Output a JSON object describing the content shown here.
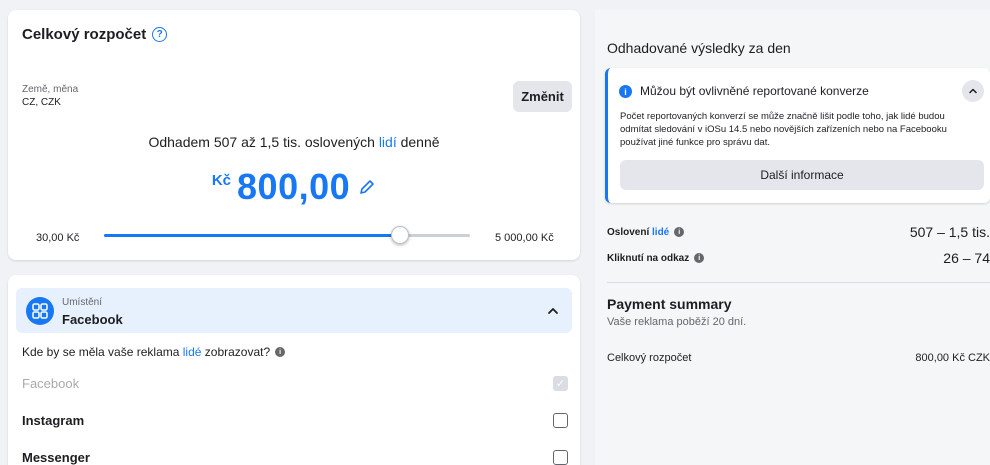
{
  "budget": {
    "title": "Celkový rozpočet",
    "country_label": "Země, měna",
    "country_value": "CZ, CZK",
    "change_button": "Změnit",
    "estimate_prefix": "Odhadem 507 až 1,5 tis. oslovených ",
    "estimate_link": "lidí",
    "estimate_suffix": " denně",
    "currency": "Kč",
    "amount": "800,00",
    "slider_min": "30,00 Kč",
    "slider_max": "5 000,00 Kč",
    "slider_level": 0.81
  },
  "placement": {
    "label": "Umístění",
    "value": "Facebook",
    "question_prefix": "Kde by se měla vaše reklama ",
    "question_link": "lidé",
    "question_suffix": " zobrazovat?",
    "platforms": [
      {
        "name": "Facebook",
        "state": "checked-disabled"
      },
      {
        "name": "Instagram",
        "state": "unchecked"
      },
      {
        "name": "Messenger",
        "state": "unchecked"
      }
    ]
  },
  "results": {
    "title": "Odhadované výsledky za den",
    "alert": {
      "title": "Můžou být ovlivněné reportované konverze",
      "body": "Počet reportovaných konverzí se může značně lišit podle toho, jak lidé budou odmítat sledování v iOSu 14.5 nebo novějších zařízeních nebo na Facebooku používat jiné funkce pro správu dat.",
      "button": "Další informace"
    },
    "reach_label_prefix": "Oslovení ",
    "reach_label_link": "lidé",
    "reach_value": "507 – 1,5 tis.",
    "clicks_label": "Kliknutí na odkaz",
    "clicks_value": "26 – 74"
  },
  "payment": {
    "title": "Payment summary",
    "subtitle": "Vaše reklama poběží 20 dní.",
    "total_label": "Celkový rozpočet",
    "total_value": "800,00 Kč CZK"
  },
  "colors": {
    "accent": "#1877f2"
  }
}
